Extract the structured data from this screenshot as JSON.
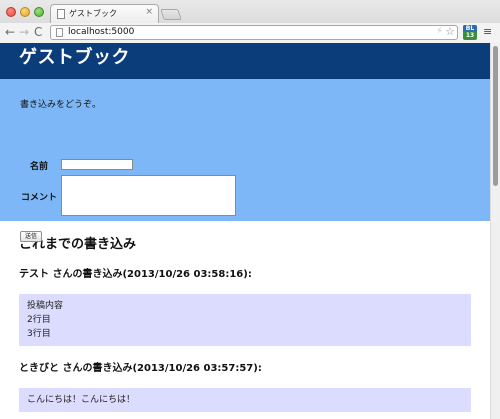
{
  "browser": {
    "tab_title": "ゲストブック",
    "tab_close": "×",
    "url": "localhost:5000",
    "nav": {
      "back": "←",
      "forward": "→",
      "reload": "C"
    },
    "extension_badge": {
      "top": "BL",
      "bottom": "13"
    },
    "menu_icon": "≡"
  },
  "page": {
    "title": "ゲストブック",
    "form": {
      "intro": "書き込みをどうぞ。",
      "name_label": "名前",
      "comment_label": "コメント",
      "name_value": "",
      "comment_value": "",
      "submit_label": "送信"
    },
    "entries_heading": "これまでの書き込み",
    "entries": [
      {
        "heading": "テスト さんの書き込み(2013/10/26 03:58:16):",
        "lines": [
          "投稿内容",
          "2行目",
          "3行目"
        ]
      },
      {
        "heading": "ときびと さんの書き込み(2013/10/26 03:57:57):",
        "lines": [
          "こんにちは！こんにちは！"
        ]
      }
    ]
  },
  "colors": {
    "header_bg": "#0a3d7a",
    "form_bg": "#7db7f7",
    "entry_bg": "#dcdcff"
  }
}
